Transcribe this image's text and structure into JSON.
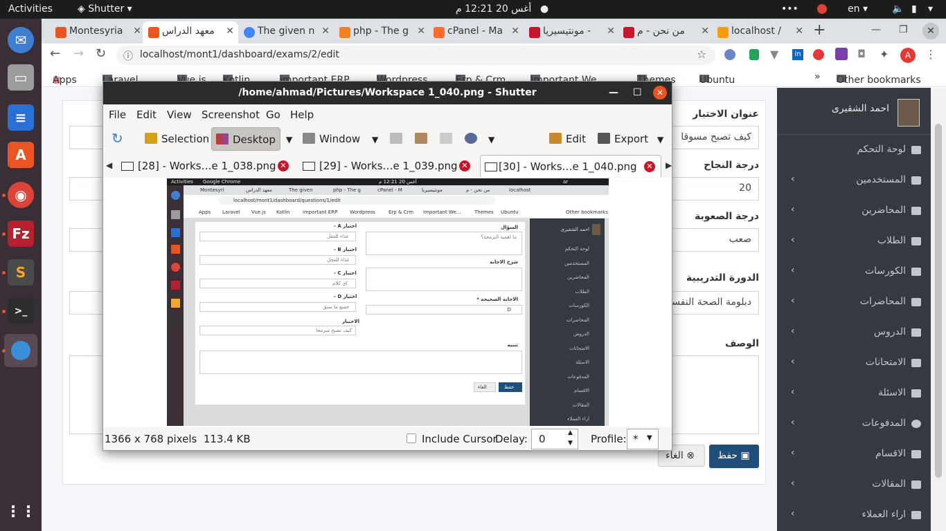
{
  "topbar": {
    "activities": "Activities",
    "app": "Shutter",
    "datetime": "أغس 20  12:21 م",
    "lang": "en"
  },
  "browser": {
    "tabs": [
      {
        "label": "Montesyria",
        "color": "#e95420"
      },
      {
        "label": "معهد الدراس",
        "color": "#e95420"
      },
      {
        "label": "The given n",
        "color": "#4285f4"
      },
      {
        "label": "php - The g",
        "color": "#f48024"
      },
      {
        "label": "cPanel - Ma",
        "color": "#ff6c2c"
      },
      {
        "label": "مونتيسيريا -",
        "color": "#c7162b"
      },
      {
        "label": "من نحن - م",
        "color": "#c7162b"
      },
      {
        "label": "localhost /",
        "color": "#f89c0e"
      }
    ],
    "url": "localhost/mont1/dashboard/exams/2/edit",
    "bookmarks": [
      "Apps",
      "Laravel",
      "Vue.js",
      "Kotlin",
      "important ERP",
      "Wordpress",
      "Erp & Crm",
      "Important We...",
      "Themes",
      "Ubuntu"
    ],
    "other_bookmarks": "Other bookmarks",
    "more": "»"
  },
  "form": {
    "title_label": "عنوان الاختبار",
    "title_value": "كيف تصبح مسوقا",
    "pass_label": "درجة النجاح",
    "pass_value": "20",
    "difficulty_label": "درجة الصعوبة",
    "difficulty_value": "صعب",
    "course_label": "الدورة التدريبية",
    "course_value": "دبلومة الصحة النفسية",
    "description_label": "الوصف",
    "save": "حفظ",
    "cancel": "الغاء"
  },
  "sidebar": {
    "user": "احمد الشقيرى",
    "items": [
      {
        "label": "لوحة التحكم",
        "chevron": false
      },
      {
        "label": "المستخدمين",
        "chevron": true
      },
      {
        "label": "المحاضرين",
        "chevron": true
      },
      {
        "label": "الطلاب",
        "chevron": true
      },
      {
        "label": "الكورسات",
        "chevron": true
      },
      {
        "label": "المحاضرات",
        "chevron": true
      },
      {
        "label": "الدروس",
        "chevron": true
      },
      {
        "label": "الامتحانات",
        "chevron": true
      },
      {
        "label": "الاسئلة",
        "chevron": true
      },
      {
        "label": "المدفوعات",
        "chevron": true
      },
      {
        "label": "الاقسام",
        "chevron": true
      },
      {
        "label": "المقالات",
        "chevron": true
      },
      {
        "label": "اراء العملاء",
        "chevron": true
      }
    ]
  },
  "shutter": {
    "title": "/home/ahmad/Pictures/Workspace 1_040.png - Shutter",
    "menu": [
      "File",
      "Edit",
      "View",
      "Screenshot",
      "Go",
      "Help"
    ],
    "toolbar": {
      "selection": "Selection",
      "desktop": "Desktop",
      "window": "Window",
      "edit": "Edit",
      "export": "Export"
    },
    "tabs": [
      "[28] - Works…e 1_038.png",
      "[29] - Works…e 1_039.png",
      "[30] - Works…e 1_040.png"
    ],
    "status": {
      "info": "1366 x 768 pixels  113.4 KB",
      "include_cursor": "Include Cursor",
      "delay_label": "Delay:",
      "delay_value": "0",
      "profile_label": "Profile:",
      "profile_value": "*"
    }
  },
  "preview": {
    "topbar": {
      "activities": "Activities",
      "app": "Google Chrome",
      "datetime": "أغس 20  12:21 م",
      "lang": "ar"
    },
    "tabs": [
      "Montesyri",
      "معهد الدراس",
      "The given",
      "php - The g",
      "cPanel - M",
      "مونتيسيريا",
      "من نحن - م",
      "localhost"
    ],
    "url": "localhost/mont1/dashboard/questions/1/edit",
    "bookmarks": [
      "Apps",
      "Laravel",
      "Vue.js",
      "Kotlin",
      "important ERP",
      "Wordpress",
      "Erp & Crm",
      "Important We...",
      "Themes",
      "Ubuntu"
    ],
    "other_bookmarks": "Other bookmarks",
    "question_label": "السؤال",
    "question_value": "ما اهمية البرمجة؟",
    "answer_expl_label": "شرح الاجابة",
    "correct_label": "الاجابة الصحيحة *",
    "correct_value": "D",
    "choice_a_label": "اختيار A -",
    "choice_a_value": "غذاء للعقل",
    "choice_b_label": "اختيار B -",
    "choice_b_value": "غذاء للعجل",
    "choice_c_label": "اختيار C -",
    "choice_c_value": "اي كلام",
    "choice_d_label": "اختيار D -",
    "choice_d_value": "جميع ما سبق",
    "exam_label": "الاختبار",
    "exam_value": "كيف تصبح مبرمجا",
    "note_label": "تنبيه",
    "save": "حفظ",
    "cancel": "الغاء",
    "user": "احمد الشقيرى",
    "sidebar": [
      "لوحة التحكم",
      "المستخدمين",
      "المحاضرين",
      "الطلاب",
      "الكورسات",
      "المحاضرات",
      "الدروس",
      "الامتحانات",
      "الاسئلة",
      "المدفوعات",
      "الاقسام",
      "المقالات",
      "اراء العملاء"
    ]
  }
}
